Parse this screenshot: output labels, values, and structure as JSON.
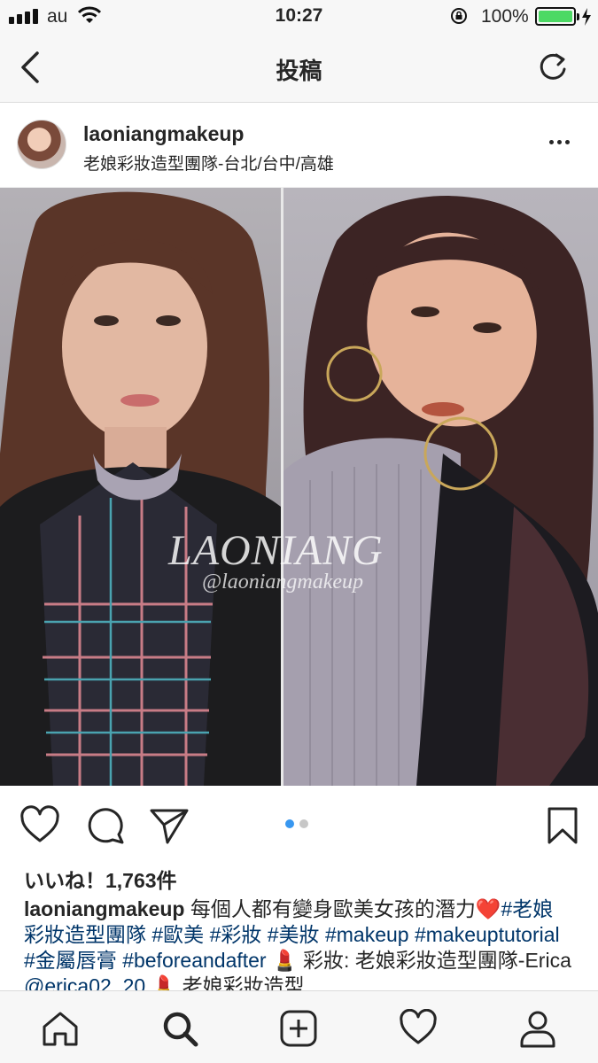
{
  "status_bar": {
    "carrier": "au",
    "time": "10:27",
    "battery_percent_text": "100%",
    "battery_level": 1.0,
    "icons": [
      "signal-icon",
      "wifi-icon",
      "orientation-lock-icon",
      "battery-icon",
      "charging-bolt-icon"
    ]
  },
  "nav": {
    "title": "投稿",
    "back_icon": "back-chevron-icon",
    "refresh_icon": "refresh-icon"
  },
  "post": {
    "username": "laoniangmakeup",
    "location": "老娘彩妝造型團隊-台北/台中/高雄",
    "watermark_main": "LAONIANG",
    "watermark_handle": "@laoniangmakeup",
    "carousel": {
      "count": 2,
      "active": 1
    },
    "likes": "いいね！1,763件",
    "caption": {
      "user": "laoniangmakeup",
      "text1": " 每個人都有變身歐美女孩的潛力",
      "heart": "❤️",
      "tag1": "#老娘彩妝造型團隊",
      "tag2": "#歐美",
      "tag3": "#彩妝",
      "tag4": "#美妝",
      "tag5": "#makeup",
      "tag6": "#makeuptutorial",
      "tag7": "#金屬唇膏",
      "tag8": "#beforeandafter",
      "lipstick1": "💄",
      "text2": " 彩妝:",
      "text3": "老娘彩妝造型團隊-Erica ",
      "mention": "@erica02_20",
      "lipstick2": "💄",
      "text4": " 老娘彩妝造型"
    }
  },
  "colors": {
    "link": "#003569",
    "carousel_active": "#3897f0",
    "battery_fill": "#4cd964"
  },
  "tabbar": {
    "icons": [
      "home-icon",
      "search-icon",
      "add-post-icon",
      "activity-heart-icon",
      "profile-icon"
    ]
  }
}
